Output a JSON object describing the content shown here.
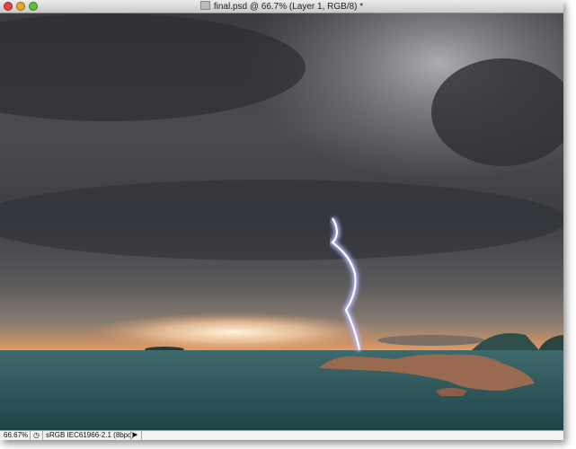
{
  "window": {
    "title": "final.psd @ 66.7% (Layer 1, RGB/8) *",
    "traffic_lights": {
      "close": "#e0443e",
      "minimize": "#e9a623",
      "zoom": "#5fbf3d"
    }
  },
  "canvas": {
    "image": "storm-lightning-over-sea-photo"
  },
  "statusbar": {
    "zoom": "66.67%",
    "profile": "sRGB IEC61966-2.1 (8bpc)",
    "status-icon": "clock-icon",
    "arrow-icon": "triangle-right-icon"
  }
}
